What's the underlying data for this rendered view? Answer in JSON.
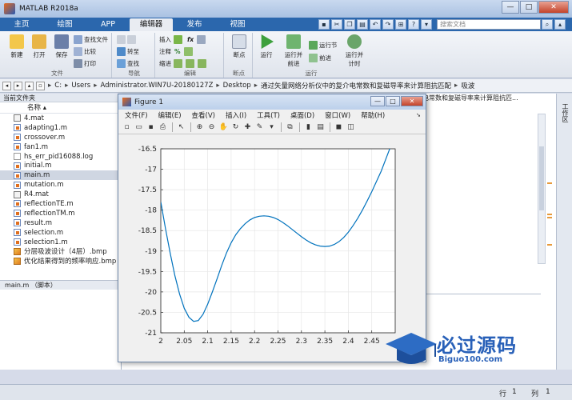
{
  "window": {
    "title": "MATLAB R2018a",
    "minimize": "—",
    "maximize": "□",
    "close": "✕"
  },
  "tabs": [
    {
      "label": "主页",
      "active": false
    },
    {
      "label": "绘图",
      "active": false
    },
    {
      "label": "APP",
      "active": false
    },
    {
      "label": "编辑器",
      "active": true
    },
    {
      "label": "发布",
      "active": false
    },
    {
      "label": "视图",
      "active": false
    }
  ],
  "search": {
    "placeholder": "搜索文档"
  },
  "ribbon": {
    "file_group": {
      "label": "文件",
      "new": "新建",
      "open": "打开",
      "save": "保存",
      "find_files": "查找文件",
      "compare": "比较",
      "print": "打印"
    },
    "nav_group": {
      "label": "导航",
      "goto": "转至",
      "find": "查找"
    },
    "edit_group": {
      "label": "编辑",
      "insert": "插入",
      "fx": "fx",
      "comment": "注释",
      "percent": "%",
      "indent": "缩进"
    },
    "breakpoint_group": {
      "label": "断点",
      "breakpoint": "断点"
    },
    "run_group": {
      "label": "运行",
      "run": "运行",
      "run_advance_1": "运行并",
      "run_advance_2": "前进",
      "run_section": "运行节",
      "advance": "前进",
      "run_time_1": "运行并",
      "run_time_2": "计时"
    }
  },
  "address": {
    "crumbs": [
      "C:",
      "Users",
      "Administrator.WIN7U-20180127Z",
      "Desktop",
      "通过矢量网络分析仪中的复介电常数和复磁导率来计算阻抗匹配",
      "吸波"
    ]
  },
  "left_panel": {
    "header": "当前文件夹",
    "column": "名称",
    "files": [
      {
        "name": "4.mat",
        "type": "mat",
        "selected": false
      },
      {
        "name": "adapting1.m",
        "type": "m",
        "selected": false
      },
      {
        "name": "crossover.m",
        "type": "m",
        "selected": false
      },
      {
        "name": "fan1.m",
        "type": "m",
        "selected": false
      },
      {
        "name": "hs_err_pid16088.log",
        "type": "log",
        "selected": false
      },
      {
        "name": "initial.m",
        "type": "m",
        "selected": false
      },
      {
        "name": "main.m",
        "type": "m",
        "selected": true
      },
      {
        "name": "mutation.m",
        "type": "m",
        "selected": false
      },
      {
        "name": "R4.mat",
        "type": "mat",
        "selected": false
      },
      {
        "name": "reflectionTE.m",
        "type": "m",
        "selected": false
      },
      {
        "name": "reflectionTM.m",
        "type": "m",
        "selected": false
      },
      {
        "name": "result.m",
        "type": "m",
        "selected": false
      },
      {
        "name": "selection.m",
        "type": "m",
        "selected": false
      },
      {
        "name": "selection1.m",
        "type": "m",
        "selected": false
      },
      {
        "name": "分层吸波设计（4层）.bmp",
        "type": "bmp",
        "selected": false
      },
      {
        "name": "优化结果得到的频率响应.bmp",
        "type": "bmp",
        "selected": false
      }
    ],
    "detail": "main.m （脚本）"
  },
  "editor_tab": "电常数和复磁导率来计算阻抗匹...",
  "workspace_label": "工作区",
  "figure": {
    "title": "Figure 1",
    "menu": [
      "文件(F)",
      "编辑(E)",
      "查看(V)",
      "插入(I)",
      "工具(T)",
      "桌面(D)",
      "窗口(W)",
      "帮助(H)"
    ]
  },
  "chart_data": {
    "type": "line",
    "title": "",
    "xlabel": "",
    "ylabel": "",
    "xlim": [
      2,
      2.5
    ],
    "ylim": [
      -21,
      -16.5
    ],
    "xticks": [
      2,
      2.05,
      2.1,
      2.15,
      2.2,
      2.25,
      2.3,
      2.35,
      2.4,
      2.45
    ],
    "yticks": [
      -16.5,
      -17,
      -17.5,
      -18,
      -18.5,
      -19,
      -19.5,
      -20,
      -20.5,
      -21
    ],
    "grid": true,
    "color": "#0072bd",
    "series": [
      {
        "x": [
          2.0,
          2.01,
          2.02,
          2.03,
          2.04,
          2.05,
          2.06,
          2.07,
          2.08,
          2.09,
          2.1,
          2.11,
          2.12,
          2.13,
          2.14,
          2.15,
          2.16,
          2.17,
          2.18,
          2.19,
          2.2,
          2.21,
          2.22,
          2.23,
          2.24,
          2.25,
          2.26,
          2.27,
          2.28,
          2.29,
          2.3,
          2.31,
          2.32,
          2.33,
          2.34,
          2.35,
          2.36,
          2.37,
          2.38,
          2.39,
          2.4,
          2.41,
          2.42,
          2.43,
          2.44,
          2.45,
          2.46,
          2.47,
          2.48,
          2.49,
          2.5
        ],
        "y": [
          -17.8,
          -18.45,
          -19.05,
          -19.6,
          -20.05,
          -20.4,
          -20.62,
          -20.72,
          -20.7,
          -20.55,
          -20.3,
          -20.0,
          -19.68,
          -19.35,
          -19.05,
          -18.8,
          -18.6,
          -18.45,
          -18.33,
          -18.24,
          -18.18,
          -18.15,
          -18.14,
          -18.15,
          -18.18,
          -18.23,
          -18.3,
          -18.38,
          -18.47,
          -18.56,
          -18.65,
          -18.73,
          -18.8,
          -18.85,
          -18.88,
          -18.89,
          -18.88,
          -18.84,
          -18.77,
          -18.67,
          -18.54,
          -18.38,
          -18.2,
          -18.0,
          -17.78,
          -17.55,
          -17.3,
          -17.05,
          -16.75,
          -16.45,
          -16.15
        ]
      }
    ]
  },
  "status": {
    "row_label": "行",
    "row": "1",
    "col_label": "列",
    "col": "1"
  },
  "watermark": {
    "title": "必过源码",
    "url": "Biguo100.com"
  }
}
